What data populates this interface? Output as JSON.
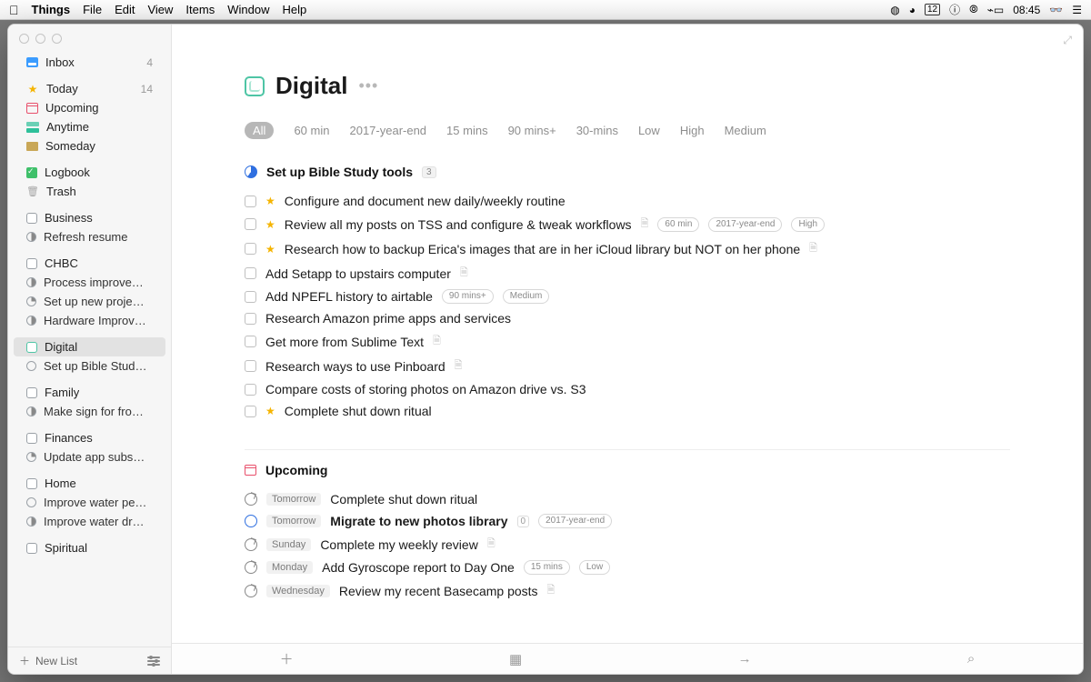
{
  "menubar": {
    "app": "Things",
    "menus": [
      "File",
      "Edit",
      "View",
      "Items",
      "Window",
      "Help"
    ],
    "clock": "08:45",
    "date": "12"
  },
  "sidebar": {
    "inbox": {
      "label": "Inbox",
      "count": "4"
    },
    "today": {
      "label": "Today",
      "count": "14"
    },
    "upcoming": {
      "label": "Upcoming"
    },
    "anytime": {
      "label": "Anytime"
    },
    "someday": {
      "label": "Someday"
    },
    "logbook": {
      "label": "Logbook"
    },
    "trash": {
      "label": "Trash"
    },
    "areas": [
      {
        "name": "Business",
        "projects": [
          {
            "name": "Refresh resume"
          }
        ]
      },
      {
        "name": "CHBC",
        "projects": [
          {
            "name": "Process improve…"
          },
          {
            "name": "Set up new proje…"
          },
          {
            "name": "Hardware Improv…"
          }
        ]
      },
      {
        "name": "Digital",
        "selected": true,
        "projects": [
          {
            "name": "Set up Bible Stud…"
          }
        ]
      },
      {
        "name": "Family",
        "projects": [
          {
            "name": "Make sign for fro…"
          }
        ]
      },
      {
        "name": "Finances",
        "projects": [
          {
            "name": "Update app subs…"
          }
        ]
      },
      {
        "name": "Home",
        "projects": [
          {
            "name": "Improve water pe…"
          },
          {
            "name": "Improve water dr…"
          }
        ]
      },
      {
        "name": "Spiritual",
        "projects": []
      }
    ],
    "newlist": "New List"
  },
  "header": {
    "title": "Digital"
  },
  "filters": [
    "All",
    "60 min",
    "2017-year-end",
    "15 mins",
    "90 mins+",
    "30-mins",
    "Low",
    "High",
    "Medium"
  ],
  "project_section": {
    "title": "Set up Bible Study tools",
    "count": "3"
  },
  "tasks": [
    {
      "star": true,
      "title": "Configure and document new daily/weekly routine"
    },
    {
      "star": true,
      "title": "Review all my posts on TSS and configure & tweak workflows",
      "note": true,
      "tags": [
        "60 min",
        "2017-year-end",
        "High"
      ]
    },
    {
      "star": true,
      "title": "Research how to backup Erica's images that are in her iCloud library but NOT on her phone",
      "note": true
    },
    {
      "title": "Add Setapp to upstairs computer",
      "note": true
    },
    {
      "title": "Add NPEFL history to airtable",
      "tags": [
        "90 mins+",
        "Medium"
      ]
    },
    {
      "title": "Research Amazon prime apps and services"
    },
    {
      "title": "Get more from Sublime Text",
      "note": true
    },
    {
      "title": "Research ways to use Pinboard",
      "note": true
    },
    {
      "title": "Compare costs of storing photos on Amazon drive vs. S3"
    },
    {
      "star": true,
      "title": "Complete shut down ritual"
    }
  ],
  "upcoming": {
    "title": "Upcoming",
    "items": [
      {
        "day": "Tomorrow",
        "title": "Complete shut down ritual"
      },
      {
        "day": "Tomorrow",
        "title": "Migrate to new photos library",
        "bold": true,
        "proj": true,
        "count": "0",
        "tags": [
          "2017-year-end"
        ]
      },
      {
        "day": "Sunday",
        "title": "Complete my weekly review",
        "note": true
      },
      {
        "day": "Monday",
        "title": "Add Gyroscope report to Day One",
        "tags": [
          "15 mins",
          "Low"
        ]
      },
      {
        "day": "Wednesday",
        "title": "Review my recent Basecamp posts",
        "note": true
      }
    ]
  }
}
